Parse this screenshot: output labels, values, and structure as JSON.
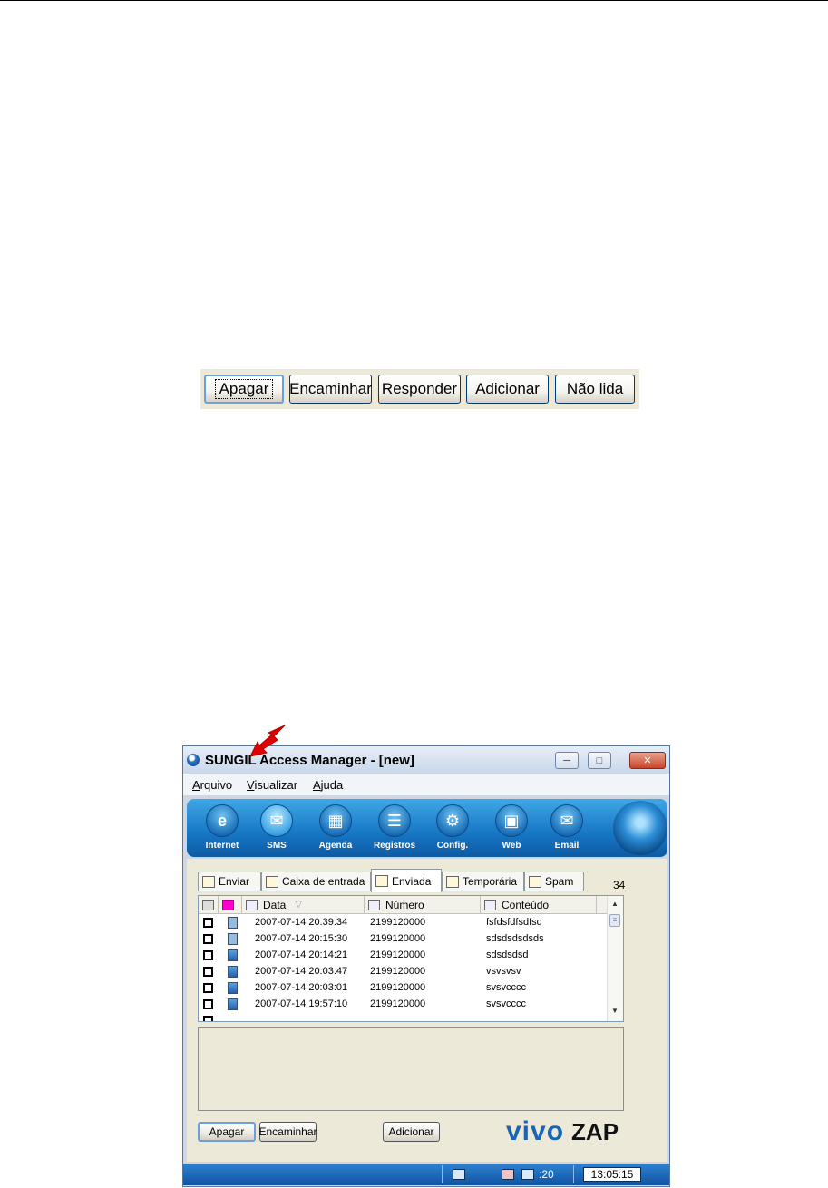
{
  "zoomed_toolbar": {
    "buttons": [
      "Apagar",
      "Encaminhar",
      "Responder",
      "Adicionar",
      "Não lida"
    ]
  },
  "window": {
    "title": "SUNGIL Access Manager - [new]",
    "controls": [
      "minimize-icon",
      "maximize-icon",
      "close-icon"
    ]
  },
  "menu": {
    "items": [
      {
        "accel": "A",
        "rest": "rquivo"
      },
      {
        "accel": "V",
        "rest": "isualizar"
      },
      {
        "accel": "A",
        "rest": "juda"
      }
    ]
  },
  "nav": {
    "items": [
      {
        "label": "Internet",
        "icon": "internet-explorer-icon"
      },
      {
        "label": "SMS",
        "icon": "envelope-icon",
        "active": true
      },
      {
        "label": "Agenda",
        "icon": "address-book-icon"
      },
      {
        "label": "Registros",
        "icon": "log-list-icon"
      },
      {
        "label": "Config.",
        "icon": "gear-icon"
      },
      {
        "label": "Web",
        "icon": "browser-window-icon"
      },
      {
        "label": "Email",
        "icon": "email-icon"
      }
    ]
  },
  "tabs": [
    "Enviar",
    "Caixa de entrada",
    "Enviada",
    "Temporária",
    "Spam"
  ],
  "active_tab": "Enviada",
  "message_count": "34",
  "table": {
    "columns": [
      "Data",
      "Número",
      "Conteúdo"
    ],
    "rows": [
      {
        "date": "2007-07-14 20:39:34",
        "number": "2199120000",
        "content": "fsfdsfdfsdfsd",
        "icon": "phone-icon"
      },
      {
        "date": "2007-07-14 20:15:30",
        "number": "2199120000",
        "content": "sdsdsdsdsds",
        "icon": "phone-icon"
      },
      {
        "date": "2007-07-14 20:14:21",
        "number": "2199120000",
        "content": "sdsdsdsd",
        "icon": "computer-icon"
      },
      {
        "date": "2007-07-14 20:03:47",
        "number": "2199120000",
        "content": "vsvsvsv",
        "icon": "computer-icon"
      },
      {
        "date": "2007-07-14 20:03:01",
        "number": "2199120000",
        "content": "svsvcccc",
        "icon": "computer-icon"
      },
      {
        "date": "2007-07-14 19:57:10",
        "number": "2199120000",
        "content": "svsvcccc",
        "icon": "computer-icon"
      }
    ]
  },
  "bottom_buttons": {
    "apagar": "Apagar",
    "encaminhar": "Encaminhar",
    "adicionar": "Adicionar"
  },
  "brand": {
    "part1": "vivo",
    "part2": "ZAP"
  },
  "status": {
    "unread_count": ":20",
    "clock": "13:05:15"
  },
  "colors": {
    "accent": "#1676c4",
    "brand_blue": "#1a64b6",
    "arrow_red": "#e00000"
  }
}
